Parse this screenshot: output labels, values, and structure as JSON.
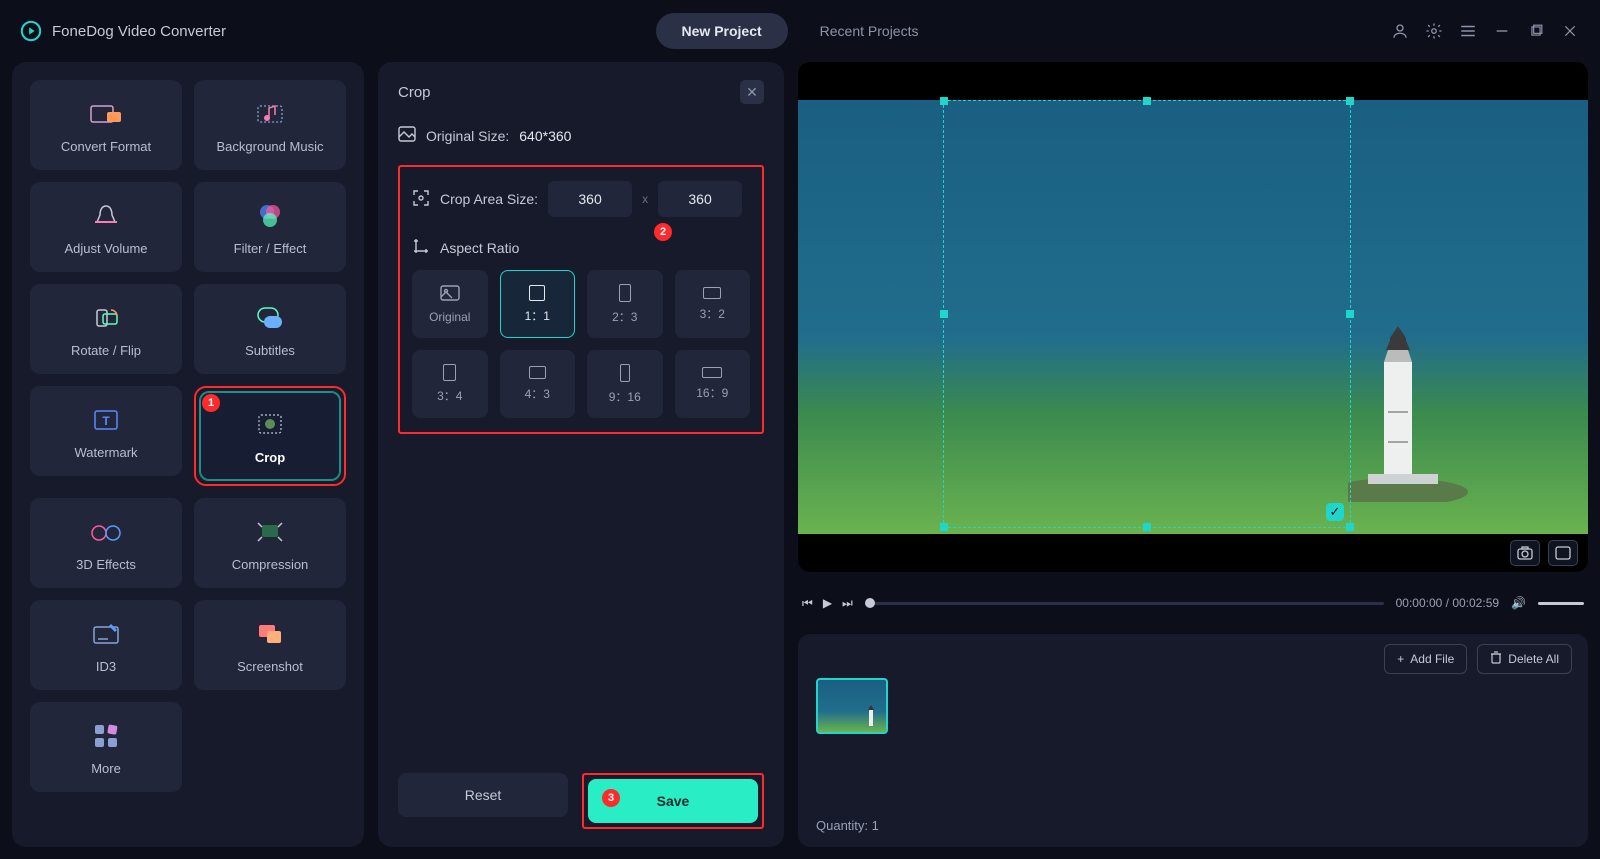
{
  "app": {
    "title": "FoneDog Video Converter"
  },
  "tabs": {
    "new_project": "New Project",
    "recent_projects": "Recent Projects"
  },
  "sidebar": {
    "items": [
      {
        "label": "Convert Format"
      },
      {
        "label": "Background Music"
      },
      {
        "label": "Adjust Volume"
      },
      {
        "label": "Filter / Effect"
      },
      {
        "label": "Rotate / Flip"
      },
      {
        "label": "Subtitles"
      },
      {
        "label": "Watermark"
      },
      {
        "label": "Crop"
      },
      {
        "label": "3D Effects"
      },
      {
        "label": "Compression"
      },
      {
        "label": "ID3"
      },
      {
        "label": "Screenshot"
      },
      {
        "label": "More"
      }
    ]
  },
  "crop_panel": {
    "title": "Crop",
    "original_size_label": "Original Size:",
    "original_size_value": "640*360",
    "crop_area_label": "Crop Area Size:",
    "crop_width": "360",
    "crop_height": "360",
    "aspect_ratio_label": "Aspect Ratio",
    "aspect_options": [
      "Original",
      "1：1",
      "2：3",
      "3：2",
      "3：4",
      "4：3",
      "9：16",
      "16：9"
    ],
    "reset_label": "Reset",
    "save_label": "Save"
  },
  "playbar": {
    "current": "00:00:00",
    "duration": "00:02:59"
  },
  "file_area": {
    "add_file": "Add File",
    "delete_all": "Delete All",
    "quantity_label": "Quantity:",
    "quantity_value": "1"
  },
  "badges": {
    "b1": "1",
    "b2": "2",
    "b3": "3"
  }
}
